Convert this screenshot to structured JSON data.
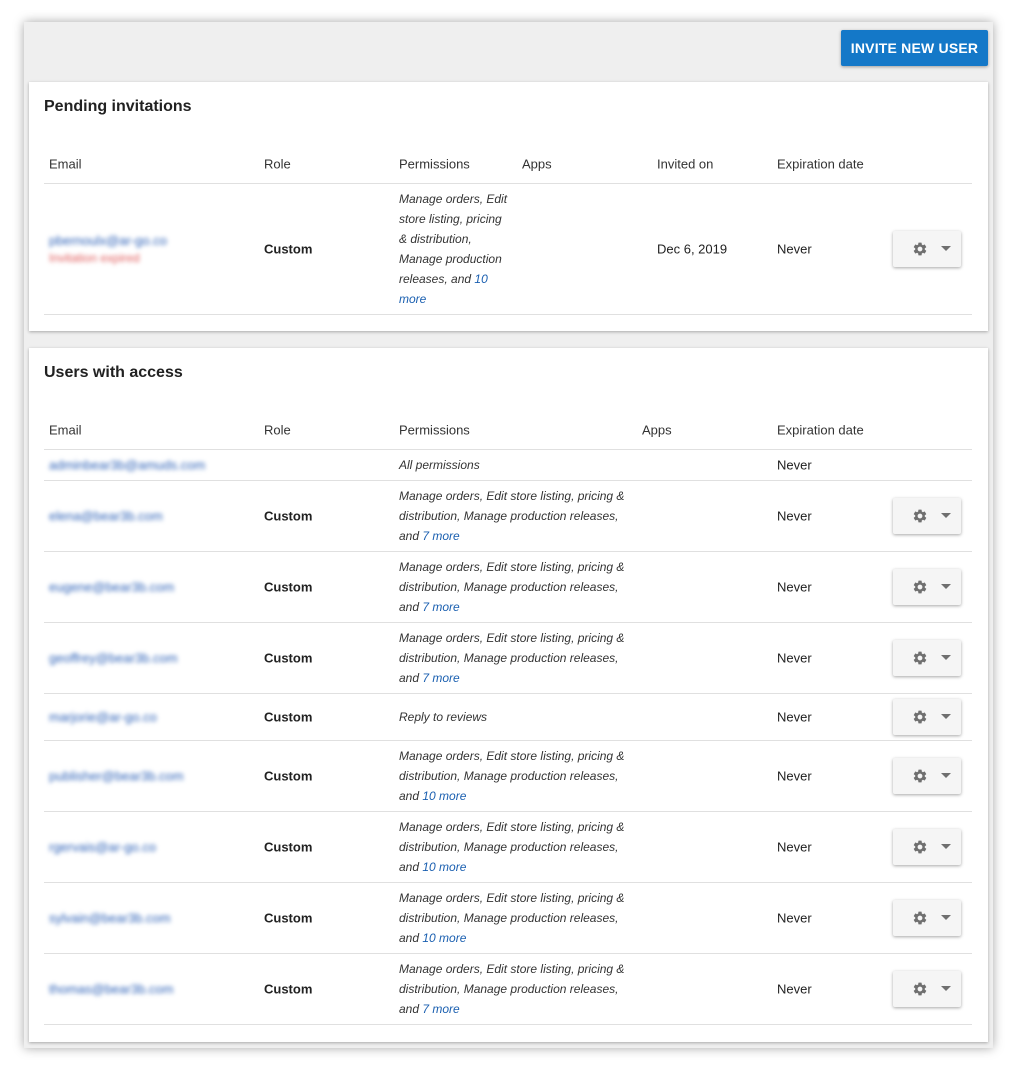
{
  "toolbar": {
    "invite_label": "INVITE NEW USER"
  },
  "colors": {
    "accent": "#1478c8",
    "link": "#1a5fb0",
    "expired": "#e05a5a"
  },
  "pending": {
    "title": "Pending invitations",
    "headers": {
      "email": "Email",
      "role": "Role",
      "permissions": "Permissions",
      "apps": "Apps",
      "invited_on": "Invited on",
      "expiration": "Expiration date"
    },
    "rows": [
      {
        "email": "pbernoulx@ar-go.co",
        "status": "Invitation expired",
        "role": "Custom",
        "permissions_lines": [
          "Manage orders, Edit",
          "store listing, pricing",
          "& distribution,",
          "Manage production",
          "releases, and "
        ],
        "more_line1": "10",
        "more_line2": "more",
        "invited_on": "Dec 6, 2019",
        "expiration": "Never",
        "actions_icon": "gear-icon"
      }
    ]
  },
  "users": {
    "title": "Users with access",
    "headers": {
      "email": "Email",
      "role": "Role",
      "permissions": "Permissions",
      "apps": "Apps",
      "expiration": "Expiration date"
    },
    "rows": [
      {
        "email": "adminbear3b@amuds.com",
        "role": "",
        "permissions_text": "All permissions",
        "expiration": "Never"
      },
      {
        "email": "elena@bear3b.com",
        "role": "Custom",
        "line1": "Manage orders, Edit store listing, pricing &",
        "line2": "distribution, Manage production releases,",
        "line3_prefix": "and ",
        "more": "7 more",
        "expiration": "Never"
      },
      {
        "email": "eugene@bear3b.com",
        "role": "Custom",
        "line1": "Manage orders, Edit store listing, pricing &",
        "line2": "distribution, Manage production releases,",
        "line3_prefix": "and ",
        "more": "7 more",
        "expiration": "Never"
      },
      {
        "email": "geoffrey@bear3b.com",
        "role": "Custom",
        "line1": "Manage orders, Edit store listing, pricing &",
        "line2": "distribution, Manage production releases,",
        "line3_prefix": "and ",
        "more": "7 more",
        "expiration": "Never"
      },
      {
        "email": "marjorie@ar-go.co",
        "role": "Custom",
        "permissions_text": "Reply to reviews",
        "expiration": "Never"
      },
      {
        "email": "publisher@bear3b.com",
        "role": "Custom",
        "line1": "Manage orders, Edit store listing, pricing &",
        "line2": "distribution, Manage production releases,",
        "line3_prefix": "and ",
        "more": "10 more",
        "expiration": "Never"
      },
      {
        "email": "rgervais@ar-go.co",
        "role": "Custom",
        "line1": "Manage orders, Edit store listing, pricing &",
        "line2": "distribution, Manage production releases,",
        "line3_prefix": "and ",
        "more": "10 more",
        "expiration": "Never"
      },
      {
        "email": "sylvain@bear3b.com",
        "role": "Custom",
        "line1": "Manage orders, Edit store listing, pricing &",
        "line2": "distribution, Manage production releases,",
        "line3_prefix": "and ",
        "more": "10 more",
        "expiration": "Never"
      },
      {
        "email": "thomas@bear3b.com",
        "role": "Custom",
        "line1": "Manage orders, Edit store listing, pricing &",
        "line2": "distribution, Manage production releases,",
        "line3_prefix": "and ",
        "more": "7 more",
        "expiration": "Never"
      }
    ]
  }
}
